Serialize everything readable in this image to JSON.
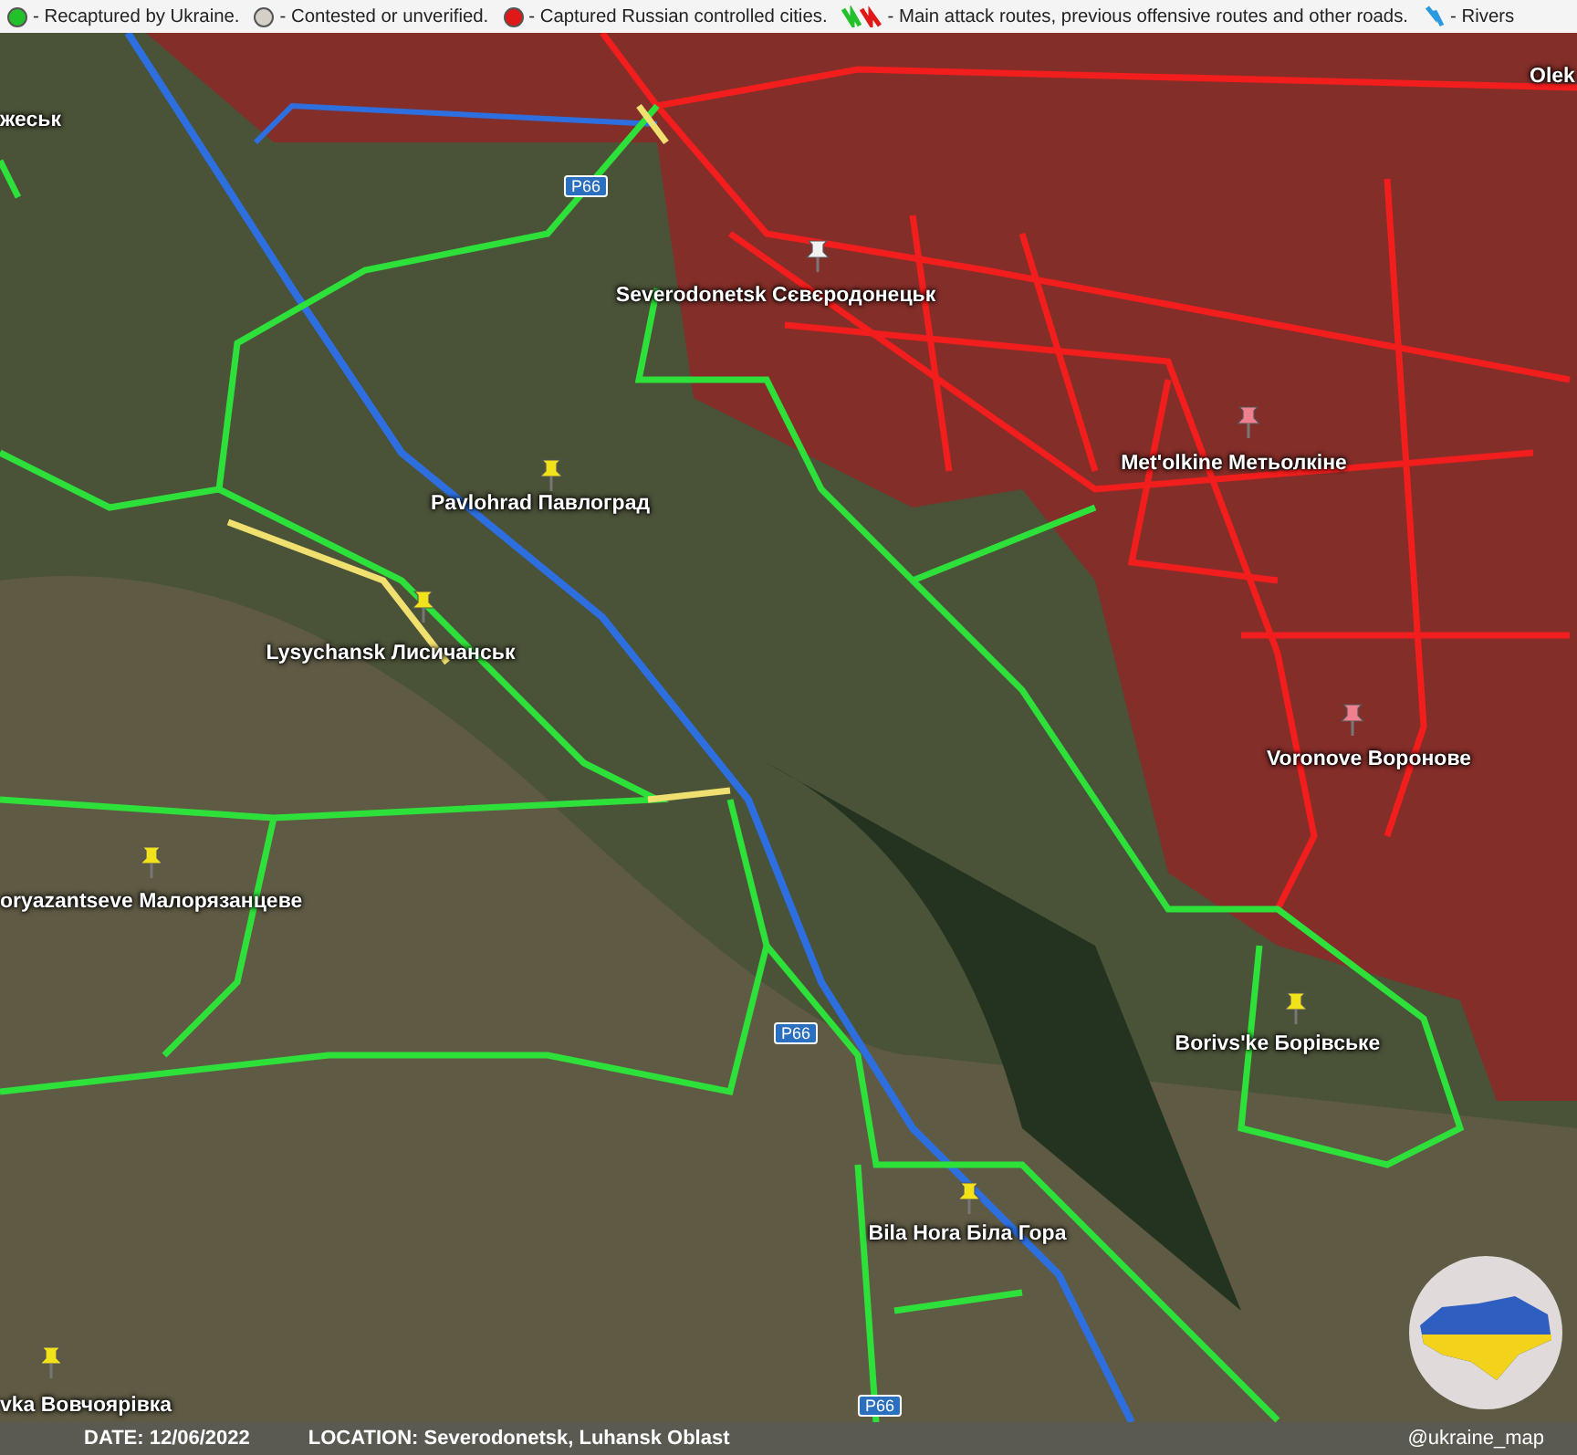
{
  "legend": [
    {
      "kind": "dot",
      "color": "#22c02a",
      "label": "- Recaptured by Ukraine."
    },
    {
      "kind": "dot",
      "color": "#d4d0c8",
      "label": "- Contested or unverified."
    },
    {
      "kind": "dot",
      "color": "#e01818",
      "label": "- Captured Russian controlled cities."
    },
    {
      "kind": "route",
      "color": "#22c02a",
      "label": "- Main attack routes, previous offensive routes and other roads."
    },
    {
      "kind": "river",
      "color": "#2a9ae0",
      "label": "- Rivers"
    }
  ],
  "map": {
    "places": [
      {
        "name": "Olek"
      },
      {
        "name": "жеськ"
      },
      {
        "name": "Severodonetsk Сєвєродонецьк",
        "color": "#f2f2f2"
      },
      {
        "name": "Pavlohrad Павлоград",
        "color": "#f2e21a"
      },
      {
        "name": "Met'olkine Метьолкіне",
        "color": "#f08090"
      },
      {
        "name": "Lysychansk Лисичанськ",
        "color": "#f2e21a"
      },
      {
        "name": "Voronove Воронове",
        "color": "#f08090"
      },
      {
        "name": "oryazantseve Малорязанцеве",
        "color": "#f2e21a"
      },
      {
        "name": "Borivs'ke Борівське",
        "color": "#f2e21a"
      },
      {
        "name": "Bila Hora Біла Гора",
        "color": "#f2e21a"
      },
      {
        "name": "vka Вовчоярівка",
        "color": "#f2e21a"
      }
    ],
    "road_labels": [
      "P66",
      "P66",
      "P66"
    ]
  },
  "footer": {
    "date": "DATE: 12/06/2022",
    "location": "LOCATION: Severodonetsk, Luhansk Oblast",
    "handle": "@ukraine_map"
  }
}
